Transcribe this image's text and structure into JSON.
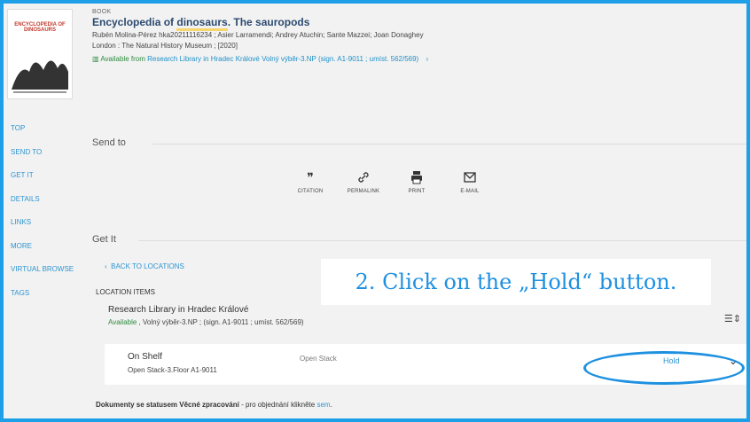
{
  "book": {
    "type_label": "BOOK",
    "title_before": "Encyclopedia of ",
    "title_highlight": "dinosaurs",
    "title_after": ". The sauropods",
    "authors": "Rubén Molina-Pérez hka20211116234 ; Asier Larramendi; Andrey Atuchin; Sante Mazzei; Joan Donaghey",
    "publisher": "London : The Natural History Museum ; [2020]",
    "availability_prefix": "Available from",
    "availability_location": "Research Library in Hradec Králové  Volný výběr-3.NP (sign. A1-9011 ; umíst. 562/569)",
    "cover_title": "ENCYCLOPEDIA OF DINOSAURS"
  },
  "nav": {
    "items": [
      "TOP",
      "SEND TO",
      "GET IT",
      "DETAILS",
      "LINKS",
      "MORE",
      "VIRTUAL BROWSE",
      "TAGS"
    ]
  },
  "send_to": {
    "heading": "Send to",
    "actions": [
      {
        "icon": "citation-icon",
        "label": "CITATION"
      },
      {
        "icon": "permalink-icon",
        "label": "PERMALINK"
      },
      {
        "icon": "print-icon",
        "label": "PRINT"
      },
      {
        "icon": "email-icon",
        "label": "E-MAIL"
      }
    ]
  },
  "get_it": {
    "heading": "Get It",
    "back_label": "BACK TO LOCATIONS",
    "location_items_label": "LOCATION ITEMS",
    "library": "Research Library in Hradec Králové",
    "library_status": "Available",
    "library_detail": " , Volný výběr-3.NP ; (sign. A1-9011 ; umíst. 562/569)",
    "item": {
      "status": "On Shelf",
      "policy": "Open Stack",
      "location": "Open Stack-3.Floor A1-9011",
      "hold_label": "Hold"
    }
  },
  "callout": "2. Click on the „Hold“ button.",
  "footnote": {
    "bold": "Dokumenty se statusem Věcné zpracování",
    "text": " - pro objednání klikněte ",
    "link": "sem",
    "end": "."
  },
  "colors": {
    "accent": "#1ea0e8",
    "link": "#2e94d0",
    "available": "#2e8b3e",
    "title": "#2b4a6f"
  }
}
